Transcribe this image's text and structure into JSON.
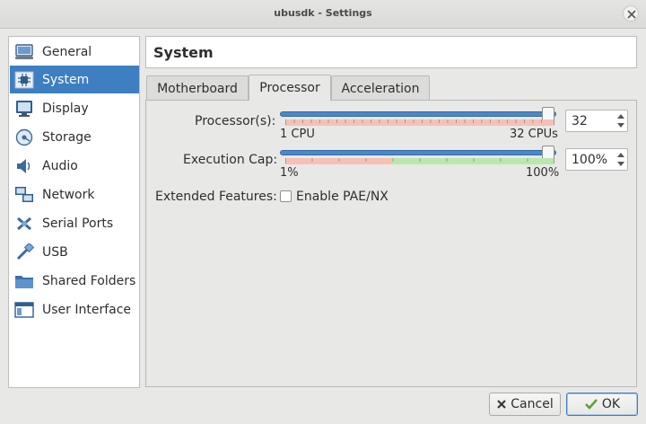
{
  "window": {
    "title": "ubusdk - Settings"
  },
  "sidebar": {
    "items": [
      {
        "label": "General",
        "icon": "general-icon"
      },
      {
        "label": "System",
        "icon": "system-icon"
      },
      {
        "label": "Display",
        "icon": "display-icon"
      },
      {
        "label": "Storage",
        "icon": "storage-icon"
      },
      {
        "label": "Audio",
        "icon": "audio-icon"
      },
      {
        "label": "Network",
        "icon": "network-icon"
      },
      {
        "label": "Serial Ports",
        "icon": "serial-ports-icon"
      },
      {
        "label": "USB",
        "icon": "usb-icon"
      },
      {
        "label": "Shared Folders",
        "icon": "shared-folders-icon"
      },
      {
        "label": "User Interface",
        "icon": "user-interface-icon"
      }
    ],
    "selected": "System"
  },
  "header": {
    "title": "System"
  },
  "tabs": [
    {
      "label": "Motherboard"
    },
    {
      "label": "Processor"
    },
    {
      "label": "Acceleration"
    }
  ],
  "active_tab": "Processor",
  "processor": {
    "cpus_label": "Processor(s):",
    "cpus_value": "32",
    "cpus_min_label": "1 CPU",
    "cpus_max_label": "32 CPUs",
    "cpus_slider_fraction": 1.0,
    "cap_label": "Execution Cap:",
    "cap_value": "100%",
    "cap_min_label": "1%",
    "cap_max_label": "100%",
    "cap_slider_fraction": 1.0,
    "ext_label": "Extended Features:",
    "pae_label": "Enable PAE/NX",
    "pae_checked": false
  },
  "buttons": {
    "cancel": "Cancel",
    "ok": "OK"
  },
  "colors": {
    "accent": "#3d7fc1",
    "warning_range": "#f6c1b4",
    "ok_range": "#b9e7b0"
  }
}
